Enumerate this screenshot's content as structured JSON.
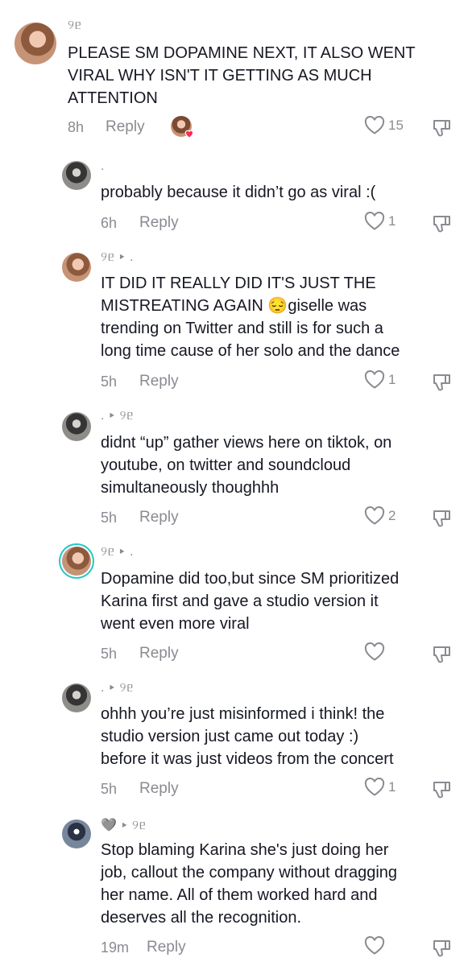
{
  "comments": [
    {
      "user": "୨ᥱ",
      "text": "PLEASE SM DOPAMINE NEXT, IT ALSO WENT\nVIRAL WHY ISN'T IT GETTING AS MUCH\nATTENTION",
      "time": "8h",
      "reply": "Reply",
      "likes": "15"
    },
    {
      "user": ".",
      "text": "probably because it didn’t go as viral :(",
      "time": "6h",
      "reply": "Reply",
      "likes": "1"
    },
    {
      "user": "୨ᥱ ▸ .",
      "text": "IT DID IT REALLY DID IT'S JUST THE\nMISTREATING AGAIN 😔giselle was\ntrending on Twitter and still is for such a\nlong time cause of her solo and the dance",
      "time": "5h",
      "reply": "Reply",
      "likes": "1"
    },
    {
      "user": ". ▸ ୨ᥱ",
      "text": "didnt “up” gather views here on tiktok, on\nyoutube, on twitter and soundcloud\nsimultaneously thoughhh",
      "time": "5h",
      "reply": "Reply",
      "likes": "2"
    },
    {
      "user": "୨ᥱ ▸ .",
      "text": "Dopamine did too,but since SM prioritized\nKarina first and gave a studio version it\nwent even more viral",
      "time": "5h",
      "reply": "Reply",
      "likes": ""
    },
    {
      "user": ". ▸ ୨ᥱ",
      "text": "ohhh you’re just misinformed i think! the\nstudio version just came out today :)\nbefore it was just videos from the concert",
      "time": "5h",
      "reply": "Reply",
      "likes": "1"
    },
    {
      "user": "🩶 ▸ ୨ᥱ",
      "text": "Stop blaming Karina she's just doing her\njob, callout the company without dragging\nher name. All of them worked hard and\ndeserves all the recognition.",
      "time": "19m",
      "reply": "Reply",
      "likes": ""
    }
  ]
}
